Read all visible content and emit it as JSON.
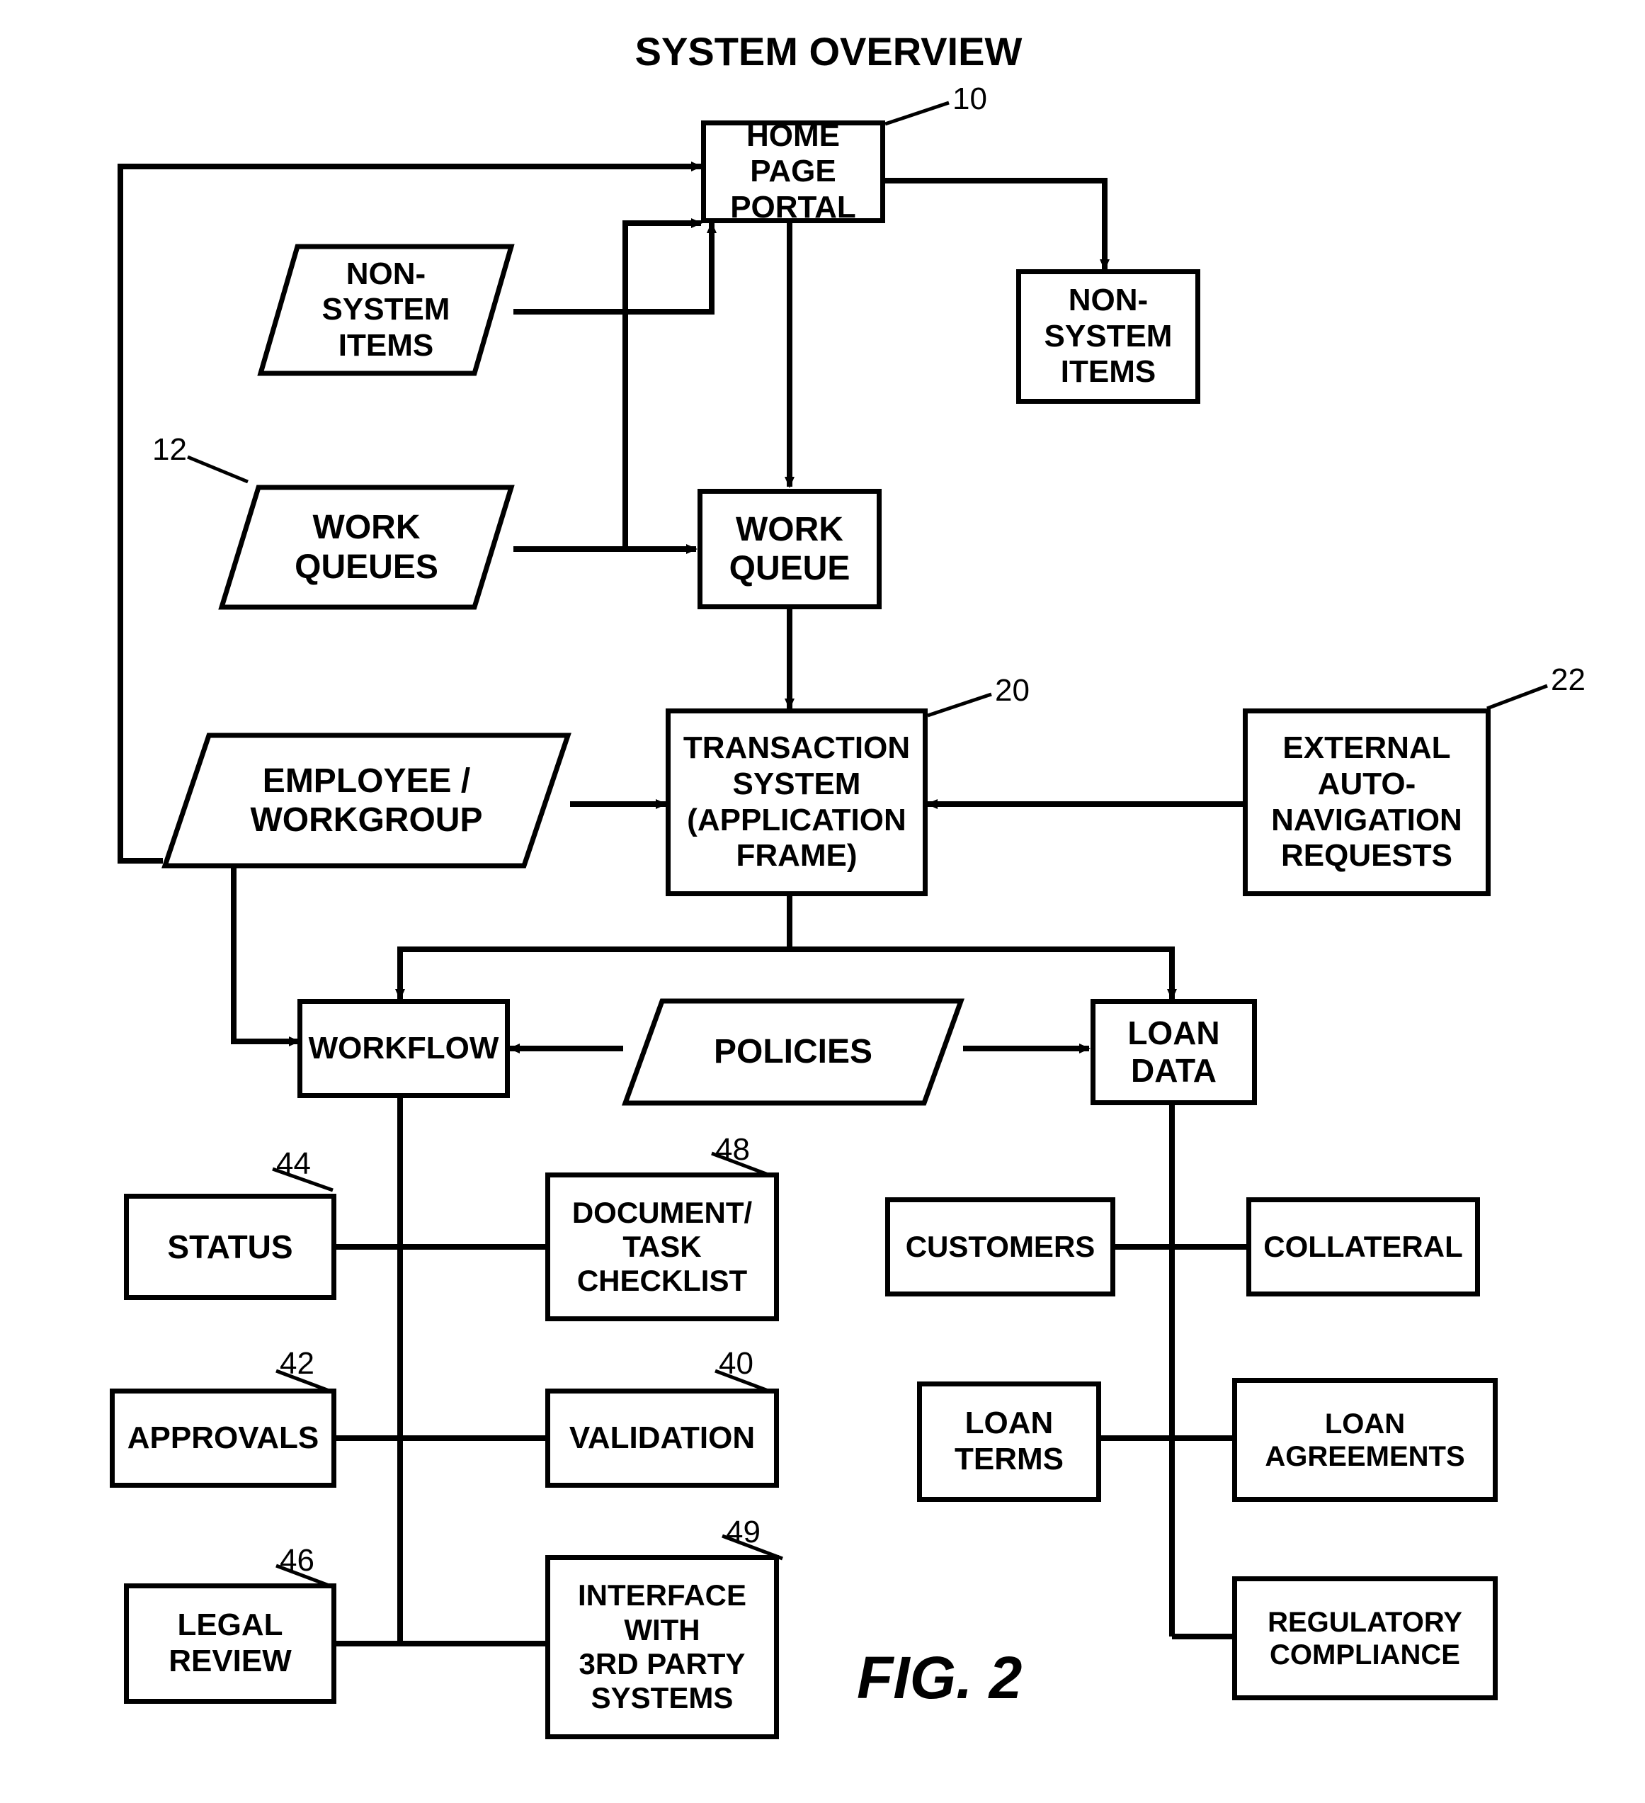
{
  "title": "SYSTEM OVERVIEW",
  "figure_label": "FIG. 2",
  "boxes": {
    "home_page_portal": "HOME\nPAGE\nPORTAL",
    "non_system_items_left": "NON-\nSYSTEM\nITEMS",
    "non_system_items_right": "NON-\nSYSTEM\nITEMS",
    "work_queues": "WORK\nQUEUES",
    "work_queue": "WORK\nQUEUE",
    "employee_workgroup": "EMPLOYEE /\nWORKGROUP",
    "transaction_system": "TRANSACTION\nSYSTEM\n(APPLICATION\nFRAME)",
    "external_auto_nav": "EXTERNAL\nAUTO-\nNAVIGATION\nREQUESTS",
    "workflow": "WORKFLOW",
    "policies": "POLICIES",
    "loan_data": "LOAN\nDATA",
    "status": "STATUS",
    "document_task_checklist": "DOCUMENT/\nTASK\nCHECKLIST",
    "approvals": "APPROVALS",
    "validation": "VALIDATION",
    "legal_review": "LEGAL\nREVIEW",
    "interface_3rd_party": "INTERFACE\nWITH\n3RD PARTY\nSYSTEMS",
    "customers": "CUSTOMERS",
    "collateral": "COLLATERAL",
    "loan_terms": "LOAN\nTERMS",
    "loan_agreements": "LOAN\nAGREEMENTS",
    "regulatory_compliance": "REGULATORY\nCOMPLIANCE"
  },
  "refs": {
    "r10": "10",
    "r12": "12",
    "r20": "20",
    "r22": "22",
    "r40": "40",
    "r42": "42",
    "r44": "44",
    "r46": "46",
    "r48": "48",
    "r49": "49"
  }
}
